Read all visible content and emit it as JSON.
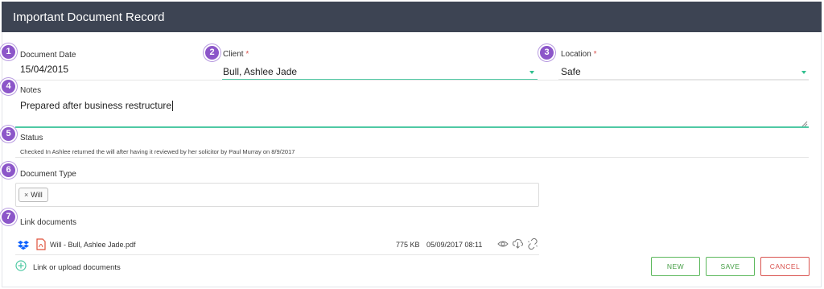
{
  "header": {
    "title": "Important Document Record"
  },
  "badges": [
    "1",
    "2",
    "3",
    "4",
    "5",
    "6",
    "7"
  ],
  "fields": {
    "document_date": {
      "label": "Document Date",
      "value": "15/04/2015"
    },
    "client": {
      "label": "Client",
      "required_mark": "*",
      "value": "Bull, Ashlee Jade"
    },
    "location": {
      "label": "Location",
      "required_mark": "*",
      "value": "Safe"
    },
    "notes": {
      "label": "Notes",
      "value": "Prepared after business restructure"
    },
    "status": {
      "label": "Status",
      "value": "Checked In Ashlee returned the will after having it reviewed by her solicitor by Paul Murray on 8/9/2017"
    },
    "document_type": {
      "label": "Document Type",
      "tags": [
        {
          "remove": "×",
          "label": "Will"
        }
      ]
    }
  },
  "link_documents": {
    "label": "Link documents",
    "files": [
      {
        "name": "Will - Bull, Ashlee Jade.pdf",
        "size": "775 KB",
        "modified": "05/09/2017 08:11"
      }
    ],
    "add_label": "Link or upload documents"
  },
  "buttons": {
    "new": "NEW",
    "save": "SAVE",
    "cancel": "CANCEL"
  },
  "colors": {
    "header_bg": "#3d4453",
    "badge": "#8c56c9",
    "accent_teal": "#4fc9a4",
    "success": "#5cb85c",
    "danger": "#d9534f"
  },
  "icons": [
    "dropbox-icon",
    "pdf-file-icon",
    "eye-icon",
    "cloud-download-icon",
    "unlink-icon",
    "add-circle-icon",
    "dropdown-arrow-icon",
    "resize-handle-icon"
  ]
}
